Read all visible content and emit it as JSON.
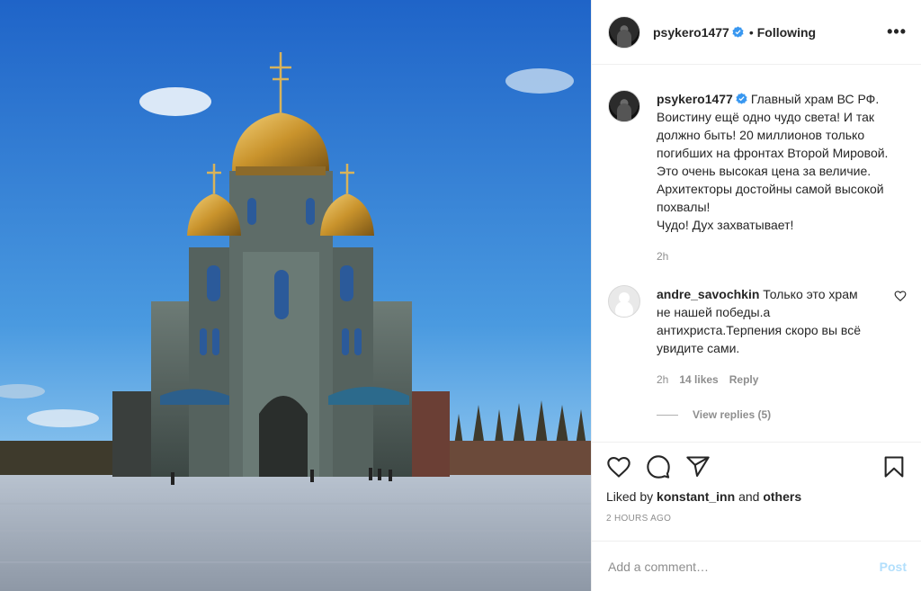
{
  "header": {
    "username": "psykero1477",
    "separator": "•",
    "follow_status": "Following",
    "more_label": "•••"
  },
  "caption": {
    "username": "psykero1477",
    "text": "Главный храм ВС РФ. Воистину ещё одно чудо света! И так должно быть! 20 миллионов только погибших на фронтах Второй Мировой. Это очень высокая цена за величие. Архитекторы достойны самой высокой похвалы!\nЧудо! Дух захватывает!",
    "time": "2h"
  },
  "comment": {
    "username": "andre_savochkin",
    "text": "Только это храм не нашей победы.а антихриста.Терпения скоро вы всё увидите сами.",
    "time": "2h",
    "likes": "14 likes",
    "reply_label": "Reply",
    "view_replies": "View replies (5)"
  },
  "actions": {
    "liked_prefix": "Liked by",
    "liked_user": "konstant_inn",
    "liked_and": "and",
    "liked_others": "others",
    "timestamp": "2 HOURS AGO"
  },
  "add_comment": {
    "placeholder": "Add a comment…",
    "post_label": "Post"
  },
  "colors": {
    "verified": "#3897f0",
    "post_button": "#b2dffc",
    "secondary_text": "#8e8e8e"
  },
  "icons": [
    "heart-icon",
    "comment-icon",
    "share-icon",
    "bookmark-icon",
    "verified-icon",
    "more-icon"
  ]
}
